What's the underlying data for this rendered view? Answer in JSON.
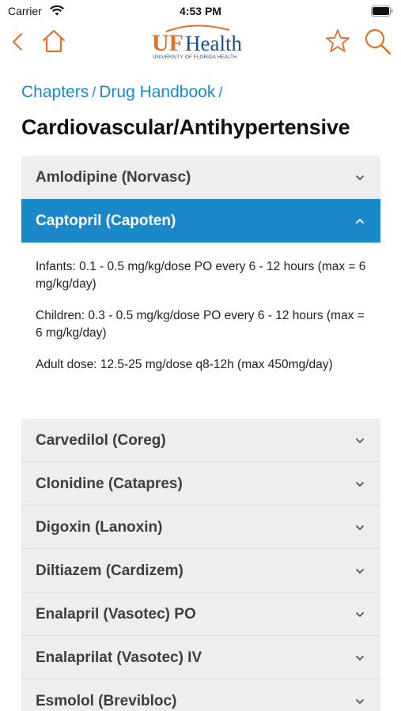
{
  "status_bar": {
    "carrier": "Carrier",
    "time": "4:53 PM",
    "wifi_icon": "wifi-icon",
    "battery_icon": "battery-icon"
  },
  "nav": {
    "back_icon": "chevron-left-icon",
    "home_icon": "home-icon",
    "logo_text_uf": "UF",
    "logo_text_health": "Health",
    "logo_subtitle": "UNIVERSITY OF FLORIDA HEALTH",
    "favorite_icon": "star-icon",
    "search_icon": "search-icon",
    "accent_color": "#e0702a"
  },
  "breadcrumb": {
    "items": [
      "Chapters",
      "Drug Handbook"
    ],
    "separator": "/"
  },
  "page_title": "Cardiovascular/Antihypertensive",
  "drugs": [
    {
      "label": "Amlodipine (Norvasc)",
      "expanded": false
    },
    {
      "label": "Captopril (Capoten)",
      "expanded": true,
      "details": [
        " Infants: 0.1 - 0.5 mg/kg/dose PO every 6 - 12 hours (max = 6 mg/kg/day)",
        "Children: 0.3 - 0.5 mg/kg/dose PO every 6 - 12 hours (max = 6 mg/kg/day)",
        "Adult dose: 12.5-25 mg/dose q8-12h (max 450mg/day)"
      ]
    },
    {
      "label": "Carvedilol (Coreg)",
      "expanded": false
    },
    {
      "label": "Clonidine (Catapres)",
      "expanded": false
    },
    {
      "label": "Digoxin (Lanoxin)",
      "expanded": false
    },
    {
      "label": "Diltiazem (Cardizem)",
      "expanded": false
    },
    {
      "label": "Enalapril (Vasotec) PO",
      "expanded": false
    },
    {
      "label": "Enalaprilat (Vasotec) IV",
      "expanded": false
    },
    {
      "label": "Esmolol (Brevibloc)",
      "expanded": false
    }
  ],
  "colors": {
    "accent_blue": "#1a88c9",
    "row_bg": "#eeeeee",
    "row_text": "#3e3e3e"
  }
}
